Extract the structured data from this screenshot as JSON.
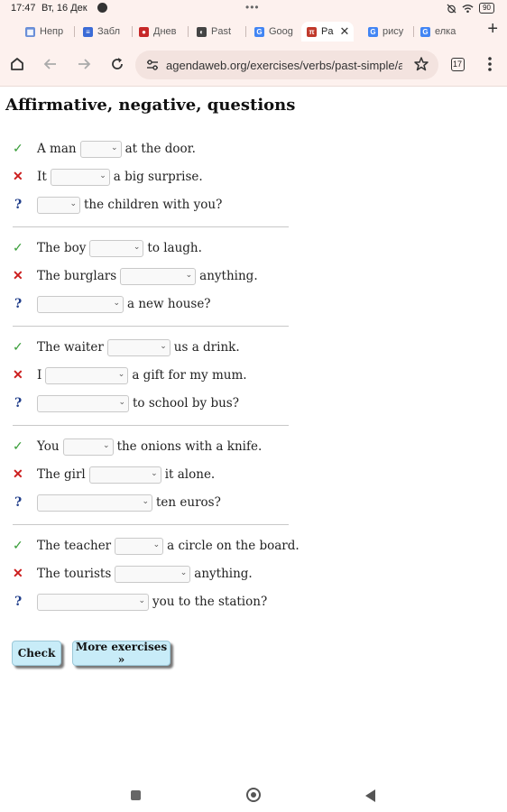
{
  "status_bar": {
    "time": "17:47",
    "date": "Вт, 16 Дек",
    "dots": "•••",
    "battery": "90"
  },
  "tabs": [
    {
      "label": "Непр",
      "icon_color": "#6a8fd8",
      "active": false
    },
    {
      "label": "Забл",
      "icon_color": "#3b6bd6",
      "active": false
    },
    {
      "label": "Днев",
      "icon_color": "#c62828",
      "active": false
    },
    {
      "label": "Past",
      "icon_color": "#444444",
      "active": false
    },
    {
      "label": "Goog",
      "icon_color": "#4285f4",
      "active": false
    },
    {
      "label": "Pa",
      "icon_color": "#c0392b",
      "active": true
    },
    {
      "label": "рису",
      "icon_color": "#4285f4",
      "active": false
    },
    {
      "label": "елка",
      "icon_color": "#4285f4",
      "active": false
    }
  ],
  "url": "agendaweb.org/exercises/verbs/past-simple/a",
  "tab_count": "17",
  "page_title": "Affirmative, negative, questions",
  "marks": {
    "affirmative": "✓",
    "negative": "✕",
    "question": "?"
  },
  "groups": [
    {
      "rows": [
        {
          "type": "affirmative",
          "before": "A man",
          "after": "at the door."
        },
        {
          "type": "negative",
          "before": "It",
          "after": "a big surprise."
        },
        {
          "type": "question",
          "before": "",
          "after": "the children with you?"
        }
      ]
    },
    {
      "rows": [
        {
          "type": "affirmative",
          "before": "The boy",
          "after": "to laugh."
        },
        {
          "type": "negative",
          "before": "The burglars",
          "after": "anything."
        },
        {
          "type": "question",
          "before": "",
          "after": "a new house?"
        }
      ]
    },
    {
      "rows": [
        {
          "type": "affirmative",
          "before": "The waiter",
          "after": "us a drink."
        },
        {
          "type": "negative",
          "before": "I",
          "after": "a gift for my mum."
        },
        {
          "type": "question",
          "before": "",
          "after": "to school by bus?"
        }
      ]
    },
    {
      "rows": [
        {
          "type": "affirmative",
          "before": "You",
          "after": "the onions with a knife."
        },
        {
          "type": "negative",
          "before": "The girl",
          "after": "it alone."
        },
        {
          "type": "question",
          "before": "",
          "after": "ten euros?"
        }
      ]
    },
    {
      "rows": [
        {
          "type": "affirmative",
          "before": "The teacher",
          "after": "a circle on the board."
        },
        {
          "type": "negative",
          "before": "The tourists",
          "after": "anything."
        },
        {
          "type": "question",
          "before": "",
          "after": "you to the station?"
        }
      ]
    }
  ],
  "buttons": {
    "check": "Check",
    "more": "More exercises »"
  },
  "colors": {
    "check_green": "#3a9e3a",
    "cross_red": "#cc1e1e",
    "question_blue": "#1f3d8a",
    "button_bg": "#c8ecf8",
    "browser_chrome": "#fdf1ee"
  }
}
